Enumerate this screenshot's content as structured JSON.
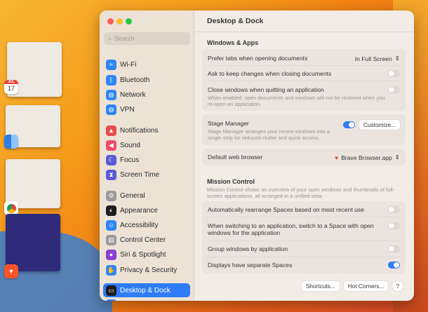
{
  "stage_apps": [
    {
      "name": "Calendar",
      "badge": "17",
      "month": "JUL"
    },
    {
      "name": "Finder"
    },
    {
      "name": "Chrome"
    },
    {
      "name": "Brave"
    }
  ],
  "sidebar": {
    "search_placeholder": "Search",
    "items": [
      {
        "label": "Wi-Fi",
        "icon": "wifi-icon",
        "color": "#2f86f6"
      },
      {
        "label": "Bluetooth",
        "icon": "bluetooth-icon",
        "color": "#2f86f6"
      },
      {
        "label": "Network",
        "icon": "globe-icon",
        "color": "#2f86f6"
      },
      {
        "label": "VPN",
        "icon": "vpn-icon",
        "color": "#2f86f6"
      },
      {
        "label": "Notifications",
        "icon": "bell-icon",
        "color": "#ea4d4d"
      },
      {
        "label": "Sound",
        "icon": "speaker-icon",
        "color": "#ea4d6a"
      },
      {
        "label": "Focus",
        "icon": "moon-icon",
        "color": "#5b5bd6"
      },
      {
        "label": "Screen Time",
        "icon": "hourglass-icon",
        "color": "#5b5bd6"
      },
      {
        "label": "General",
        "icon": "gear-icon",
        "color": "#9a9a9e"
      },
      {
        "label": "Appearance",
        "icon": "appearance-icon",
        "color": "#1d1d1f"
      },
      {
        "label": "Accessibility",
        "icon": "accessibility-icon",
        "color": "#2f86f6"
      },
      {
        "label": "Control Center",
        "icon": "control-center-icon",
        "color": "#9a9a9e"
      },
      {
        "label": "Siri & Spotlight",
        "icon": "siri-icon",
        "color": "#8a3fd1"
      },
      {
        "label": "Privacy & Security",
        "icon": "hand-icon",
        "color": "#2f86f6"
      },
      {
        "label": "Desktop & Dock",
        "icon": "dock-icon",
        "color": "#1d1d1f",
        "selected": true
      },
      {
        "label": "Displays",
        "icon": "display-icon",
        "color": "#2f86f6"
      }
    ]
  },
  "main": {
    "title": "Desktop & Dock",
    "windows_apps": {
      "heading": "Windows & Apps",
      "prefer_tabs": {
        "label": "Prefer tabs when opening documents",
        "value": "In Full Screen"
      },
      "ask_keep": {
        "label": "Ask to keep changes when closing documents",
        "on": false
      },
      "close_windows": {
        "label": "Close windows when quitting an application",
        "desc": "When enabled, open documents and windows will not be restored when you re-open an application.",
        "on": false
      },
      "stage_manager": {
        "label": "Stage Manager",
        "desc": "Stage Manager arranges your recent windows into a single strip for reduced clutter and quick access.",
        "on": true,
        "button": "Customize..."
      },
      "browser": {
        "label": "Default web browser",
        "value": "Brave Browser.app"
      }
    },
    "mission_control": {
      "heading": "Mission Control",
      "desc": "Mission Control shows an overview of your open windows and thumbnails of full-screen applications, all arranged in a unified view.",
      "rows": [
        {
          "label": "Automatically rearrange Spaces based on most recent use",
          "on": false
        },
        {
          "label": "When switching to an application, switch to a Space with open windows for the application",
          "on": false
        },
        {
          "label": "Group windows by application",
          "on": false
        },
        {
          "label": "Displays have separate Spaces",
          "on": true
        }
      ]
    },
    "buttons": {
      "shortcuts": "Shortcuts...",
      "hot_corners": "Hot Corners...",
      "help": "?"
    }
  }
}
